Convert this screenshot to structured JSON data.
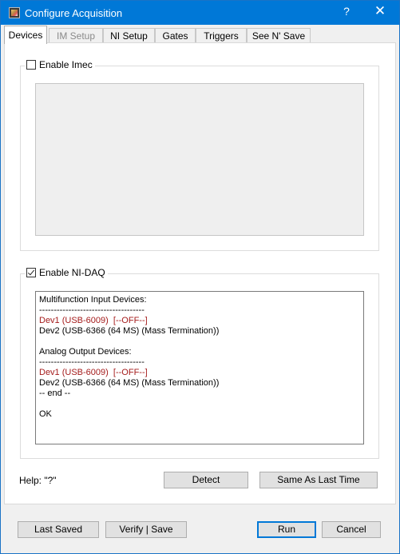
{
  "window": {
    "title": "Configure Acquisition",
    "help_glyph": "?",
    "close_glyph": "✕",
    "icon": "app-icon",
    "accent_color": "#0078d7"
  },
  "tabs": [
    {
      "label": "Devices",
      "active": true,
      "enabled": true
    },
    {
      "label": "IM Setup",
      "active": false,
      "enabled": false
    },
    {
      "label": "NI Setup",
      "active": false,
      "enabled": true
    },
    {
      "label": "Gates",
      "active": false,
      "enabled": true
    },
    {
      "label": "Triggers",
      "active": false,
      "enabled": true
    },
    {
      "label": "See N' Save",
      "active": false,
      "enabled": true
    }
  ],
  "imec": {
    "label": "Enable Imec",
    "checked": false
  },
  "nidaq": {
    "label": "Enable NI-DAQ",
    "checked": true,
    "log": [
      {
        "text": "Multifunction Input Devices:",
        "color": "#000000"
      },
      {
        "text": "------------------------------------",
        "color": "#000000"
      },
      {
        "text": "Dev1 (USB-6009)  [--OFF--]",
        "color": "#a41b1b"
      },
      {
        "text": "Dev2 (USB-6366 (64 MS) (Mass Termination))",
        "color": "#000000"
      },
      {
        "text": "",
        "color": "#000000"
      },
      {
        "text": "Analog Output Devices:",
        "color": "#000000"
      },
      {
        "text": "------------------------------------",
        "color": "#000000"
      },
      {
        "text": "Dev1 (USB-6009)  [--OFF--]",
        "color": "#a41b1b"
      },
      {
        "text": "Dev2 (USB-6366 (64 MS) (Mass Termination))",
        "color": "#000000"
      },
      {
        "text": "-- end --",
        "color": "#000000"
      },
      {
        "text": "",
        "color": "#000000"
      },
      {
        "text": "OK",
        "color": "#000000"
      }
    ]
  },
  "help": {
    "text": "Help: \"?\""
  },
  "buttons": {
    "detect": "Detect",
    "same_as_last": "Same As Last Time",
    "last_saved": "Last Saved",
    "verify_save": "Verify | Save",
    "run": "Run",
    "cancel": "Cancel"
  }
}
